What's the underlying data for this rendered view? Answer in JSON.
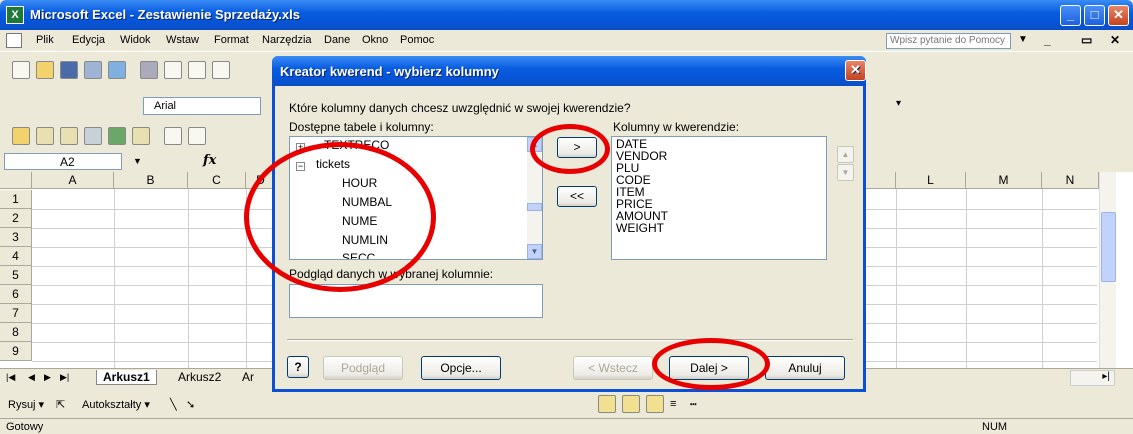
{
  "window": {
    "title": "Microsoft Excel - Zestawienie Sprzedaży.xls",
    "app_icon_letter": "X"
  },
  "menu": {
    "items": [
      "Plik",
      "Edycja",
      "Widok",
      "Wstaw",
      "Format",
      "Narzędzia",
      "Dane",
      "Okno",
      "Pomoc"
    ],
    "help_placeholder": "Wpisz pytanie do Pomocy"
  },
  "toolbar": {
    "font_name": "Arial"
  },
  "formula": {
    "cell_ref": "A2",
    "fx": "fx"
  },
  "grid": {
    "columns": [
      "A",
      "B",
      "C",
      "D",
      "L",
      "M",
      "N"
    ],
    "rows": [
      "1",
      "2",
      "3",
      "4",
      "5",
      "6",
      "7",
      "8",
      "9"
    ]
  },
  "sheets": {
    "tabs": [
      "Arkusz1",
      "Arkusz2",
      "Ar"
    ],
    "active": "Arkusz1"
  },
  "drawbar": {
    "draw": "Rysuj ▾",
    "autoshapes": "Autokształty ▾"
  },
  "status": {
    "left": "Gotowy",
    "num": "NUM"
  },
  "dialog": {
    "title": "Kreator kwerend - wybierz kolumny",
    "question": "Które kolumny danych chcesz uwzględnić w swojej kwerendzie?",
    "available_label": "Dostępne tabele i kolumny:",
    "query_columns_label": "Kolumny w kwerendzie:",
    "tree": {
      "collapsed_table": "TEXTRECO",
      "expanded_table": "tickets",
      "columns": [
        "HOUR",
        "NUMBAL",
        "NUME",
        "NUMLIN",
        "SECC"
      ]
    },
    "query_columns": [
      "DATE",
      "VENDOR",
      "PLU",
      "CODE",
      "ITEM",
      "PRICE",
      "AMOUNT",
      "WEIGHT"
    ],
    "add_button": ">",
    "remove_button": "<<",
    "preview_label": "Podgląd danych w wybranej kolumnie:",
    "buttons": {
      "preview": "Podgląd",
      "options": "Opcje...",
      "back": "< Wstecz",
      "next": "Dalej >",
      "cancel": "Anuluj"
    }
  },
  "colors": {
    "title_blue": "#0a5ee0",
    "annotation_red": "#e80000",
    "xp_face": "#ece9d8"
  }
}
